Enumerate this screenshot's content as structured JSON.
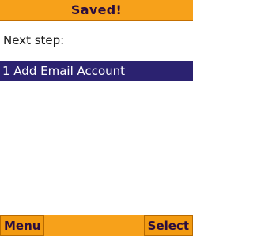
{
  "header": {
    "title": "Saved!"
  },
  "content": {
    "prompt": "Next step:",
    "items": [
      {
        "label": "1 Add Email Account",
        "selected": true
      }
    ]
  },
  "softkeys": {
    "left": "Menu",
    "right": "Select"
  },
  "colors": {
    "accent": "#f7a11a",
    "selection": "#2b2270",
    "text_dark": "#2a0d3e"
  }
}
